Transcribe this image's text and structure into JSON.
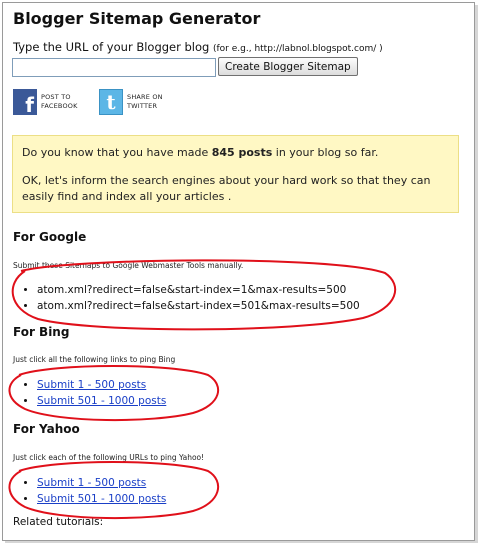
{
  "page": {
    "title": "Blogger Sitemap Generator",
    "url_prompt": "Type the URL of your Blogger blog",
    "url_example": "(for e.g., http://labnol.blogspot.com/ )",
    "url_value": "",
    "create_button": "Create Blogger Sitemap"
  },
  "share": {
    "facebook": {
      "icon_glyph": "f",
      "line1": "POST TO",
      "line2": "FACEBOOK"
    },
    "twitter": {
      "icon_glyph": "t",
      "line1": "SHARE ON",
      "line2": "TWITTER"
    }
  },
  "notice": {
    "line1_pre": "Do you know that you have made ",
    "post_count": "845 posts",
    "line1_post": " in your blog so far.",
    "line2": "OK, let's inform the search engines about your hard work so that they can easily find and index all your articles ."
  },
  "google": {
    "heading": "For Google",
    "instruction": "Submit these Sitemaps to Google Webmaster Tools manually.",
    "items": [
      "atom.xml?redirect=false&start-index=1&max-results=500",
      "atom.xml?redirect=false&start-index=501&max-results=500"
    ]
  },
  "bing": {
    "heading": "For Bing",
    "instruction": "Just click all the following links to ping Bing",
    "links": [
      "Submit 1 - 500 posts",
      "Submit 501 - 1000 posts"
    ]
  },
  "yahoo": {
    "heading": "For Yahoo",
    "instruction": "Just click each of the following URLs to ping Yahoo!",
    "links": [
      "Submit 1 - 500 posts",
      "Submit 501 - 1000 posts"
    ]
  },
  "related": "Related tutorials:",
  "colors": {
    "link": "#1a3fc7",
    "annotation": "#e0101a",
    "notice_bg": "#fff8c4",
    "facebook": "#3b5998",
    "twitter": "#5cb6e6"
  }
}
